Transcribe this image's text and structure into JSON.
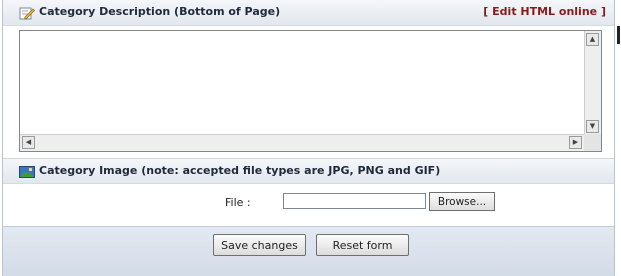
{
  "description_section": {
    "title": "Category Description (Bottom of Page)",
    "edit_link_open": "[",
    "edit_link_label": "Edit HTML online",
    "edit_link_close": "]",
    "text_value": ""
  },
  "image_section": {
    "title": "Category Image (note: accepted file types are JPG, PNG and GIF)",
    "file_label": "File :",
    "file_value": "",
    "browse_label": "Browse..."
  },
  "actions": {
    "save_label": "Save changes",
    "reset_label": "Reset form"
  },
  "icons": {
    "description_icon": "edit-pencil-icon",
    "image_icon": "picture-icon"
  },
  "colors": {
    "edit_link": "#8a1a1a",
    "header_bg": "#e2e7ee",
    "footer_bg": "#d3dbe7"
  }
}
